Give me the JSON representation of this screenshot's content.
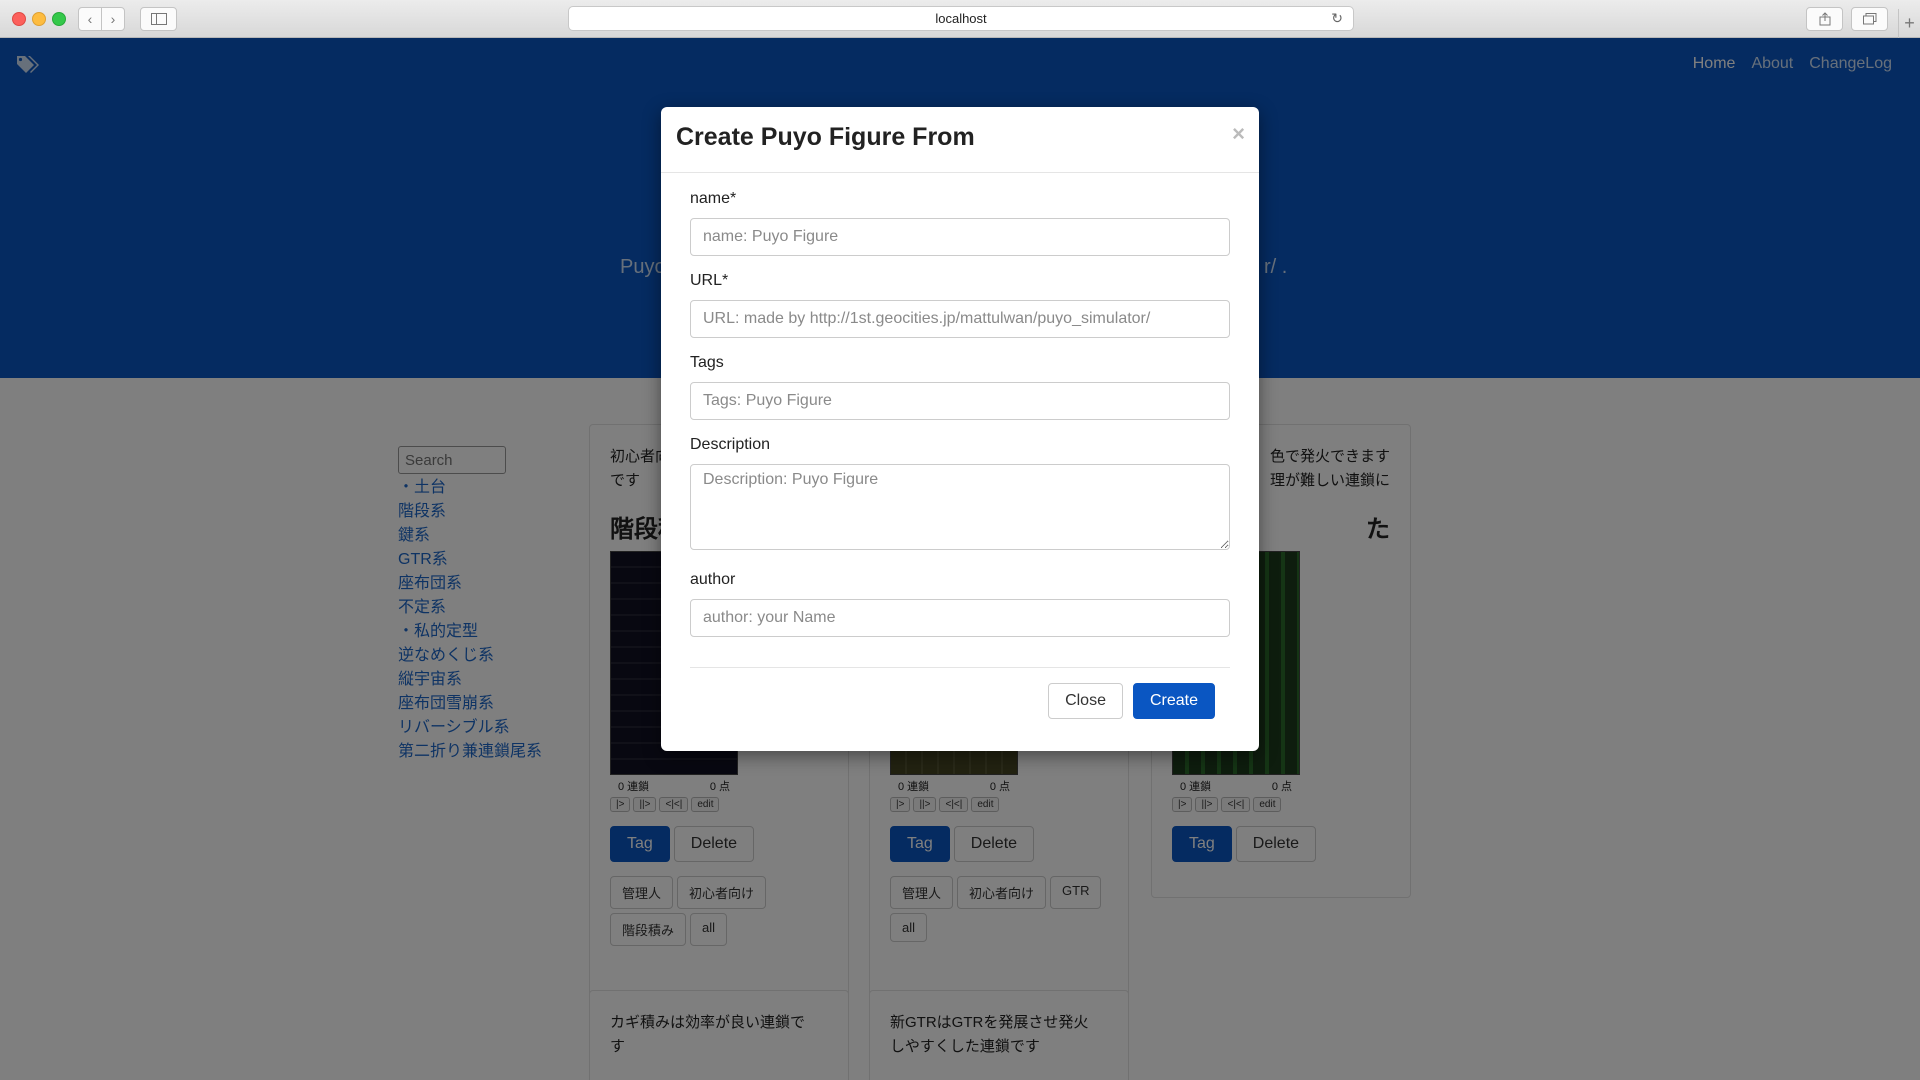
{
  "browser": {
    "address": "localhost",
    "icons": {
      "back": "chevron-left-icon",
      "forward": "chevron-right-icon",
      "sidebar": "sidebar-icon",
      "reload": "reload-icon",
      "share": "share-icon",
      "tabs": "tabs-icon",
      "new_tab": "plus-icon"
    }
  },
  "navbar": {
    "brand_icon": "tags-icon",
    "links": [
      "Home",
      "About",
      "ChangeLog"
    ],
    "active": "Home"
  },
  "hero": {
    "text_left": "Puyo",
    "text_right": "r/ ."
  },
  "sidebar": {
    "search_placeholder": "Search",
    "items": [
      "・土台",
      "階段系",
      "鍵系",
      "GTR系",
      "座布団系",
      "不定系",
      "・私的定型",
      "逆なめくじ系",
      "縦宇宙系",
      "座布団雪崩系",
      "リバーシブル系",
      "第二折り兼連鎖尾系"
    ]
  },
  "cards": [
    {
      "desc": "初心者向\nです",
      "title": "階段積",
      "chain": "0 連鎖",
      "score": "0 点",
      "controls": [
        "|>",
        "||>",
        "<|<|",
        "edit"
      ],
      "buttons": {
        "tag": "Tag",
        "delete": "Delete"
      },
      "tags": [
        "管理人",
        "初心者向け",
        "階段積み",
        "all"
      ]
    },
    {
      "desc": "",
      "title": "",
      "chain": "0 連鎖",
      "score": "0 点",
      "controls": [
        "|>",
        "||>",
        "<|<|",
        "edit"
      ],
      "buttons": {
        "tag": "Tag",
        "delete": "Delete"
      },
      "tags": [
        "管理人",
        "初心者向け",
        "GTR",
        "all"
      ]
    },
    {
      "desc": "色で発火できます\n理が難しい連鎖に",
      "title": "た",
      "chain": "0 連鎖",
      "score": "0 点",
      "controls": [
        "|>",
        "||>",
        "<|<|",
        "edit"
      ],
      "buttons": {
        "tag": "Tag",
        "delete": "Delete"
      },
      "tags": []
    },
    {
      "desc": "カギ積みは効率が良い連鎖で\nす"
    },
    {
      "desc": "新GTRはGTRを発展させ発火\nしやすくした連鎖です"
    }
  ],
  "modal": {
    "title": "Create Puyo Figure From",
    "close_icon": "×",
    "fields": {
      "name": {
        "label": "name*",
        "placeholder": "name: Puyo Figure"
      },
      "url": {
        "label": "URL*",
        "placeholder": "URL: made by http://1st.geocities.jp/mattulwan/puyo_simulator/"
      },
      "tags": {
        "label": "Tags",
        "placeholder": "Tags: Puyo Figure"
      },
      "description": {
        "label": "Description",
        "placeholder": "Description: Puyo Figure"
      },
      "author": {
        "label": "author",
        "placeholder": "author: your Name"
      }
    },
    "footer": {
      "close": "Close",
      "create": "Create"
    }
  },
  "colors": {
    "primary": "#0a56c2",
    "link": "#1c66c8",
    "overlay": "rgba(0,0,0,0.5)"
  }
}
